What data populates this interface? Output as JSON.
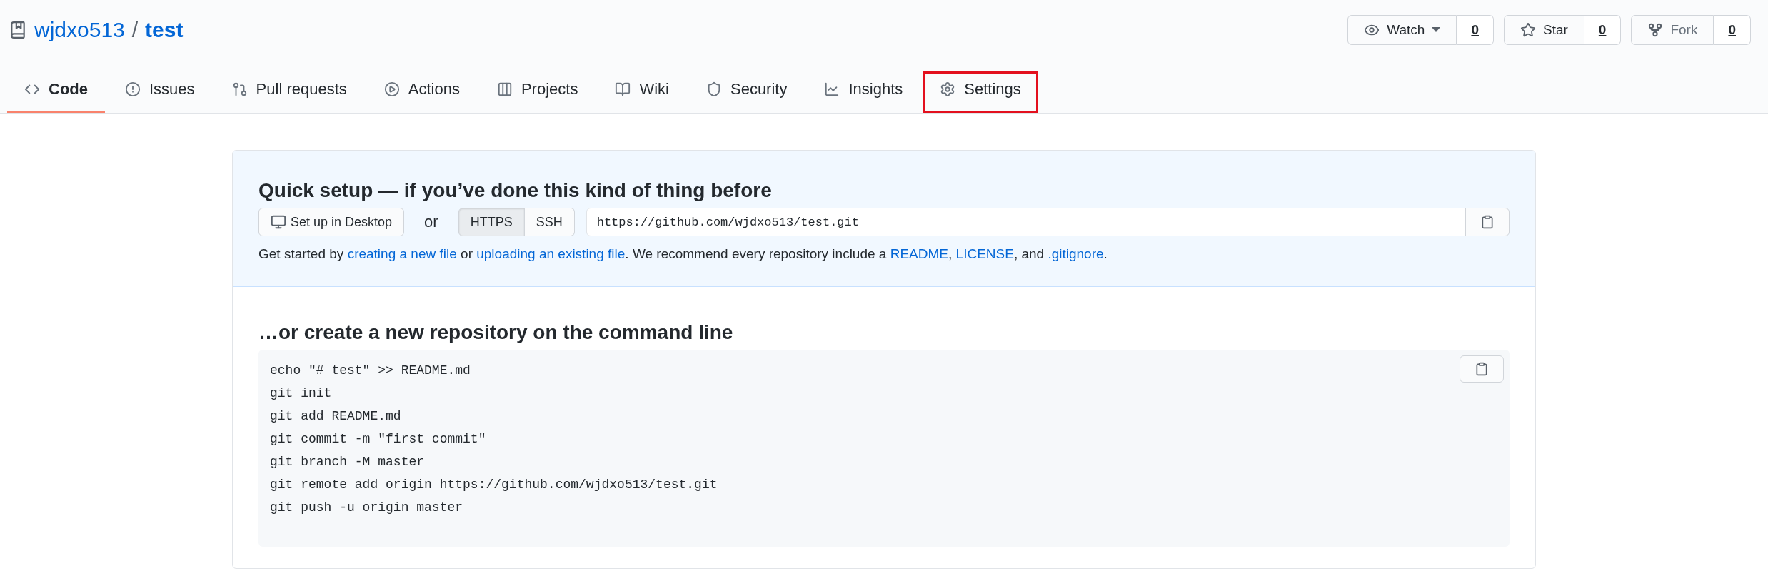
{
  "repo": {
    "owner": "wjdxo513",
    "separator": "/",
    "name": "test"
  },
  "actions": [
    {
      "kind": "watch",
      "label": "Watch",
      "count": "0",
      "disabled": false
    },
    {
      "kind": "star",
      "label": "Star",
      "count": "0",
      "disabled": false
    },
    {
      "kind": "fork",
      "label": "Fork",
      "count": "0",
      "disabled": true
    }
  ],
  "tabs": [
    {
      "label": "Code",
      "selected": true,
      "highlighted": false
    },
    {
      "label": "Issues",
      "selected": false,
      "highlighted": false
    },
    {
      "label": "Pull requests",
      "selected": false,
      "highlighted": false
    },
    {
      "label": "Actions",
      "selected": false,
      "highlighted": false
    },
    {
      "label": "Projects",
      "selected": false,
      "highlighted": false
    },
    {
      "label": "Wiki",
      "selected": false,
      "highlighted": false
    },
    {
      "label": "Security",
      "selected": false,
      "highlighted": false
    },
    {
      "label": "Insights",
      "selected": false,
      "highlighted": false
    },
    {
      "label": "Settings",
      "selected": false,
      "highlighted": true
    }
  ],
  "quick_setup": {
    "title": "Quick setup — if you’ve done this kind of thing before",
    "desktop_button": "Set up in Desktop",
    "or": "or",
    "protocols": [
      {
        "label": "HTTPS",
        "selected": true
      },
      {
        "label": "SSH",
        "selected": false
      }
    ],
    "url": "https://github.com/wjdxo513/test.git",
    "description": [
      {
        "text": "Get started by ",
        "link": false
      },
      {
        "text": "creating a new file",
        "link": true
      },
      {
        "text": " or ",
        "link": false
      },
      {
        "text": "uploading an existing file",
        "link": true
      },
      {
        "text": ". We recommend every repository include a ",
        "link": false
      },
      {
        "text": "README",
        "link": true
      },
      {
        "text": ", ",
        "link": false
      },
      {
        "text": "LICENSE",
        "link": true
      },
      {
        "text": ", and ",
        "link": false
      },
      {
        "text": ".gitignore",
        "link": true
      },
      {
        "text": ".",
        "link": false
      }
    ]
  },
  "command_line": {
    "title": "…or create a new repository on the command line",
    "lines": [
      "echo \"# test\" >> README.md",
      "git init",
      "git add README.md",
      "git commit -m \"first commit\"",
      "git branch -M master",
      "git remote add origin https://github.com/wjdxo513/test.git",
      "git push -u origin master"
    ]
  }
}
